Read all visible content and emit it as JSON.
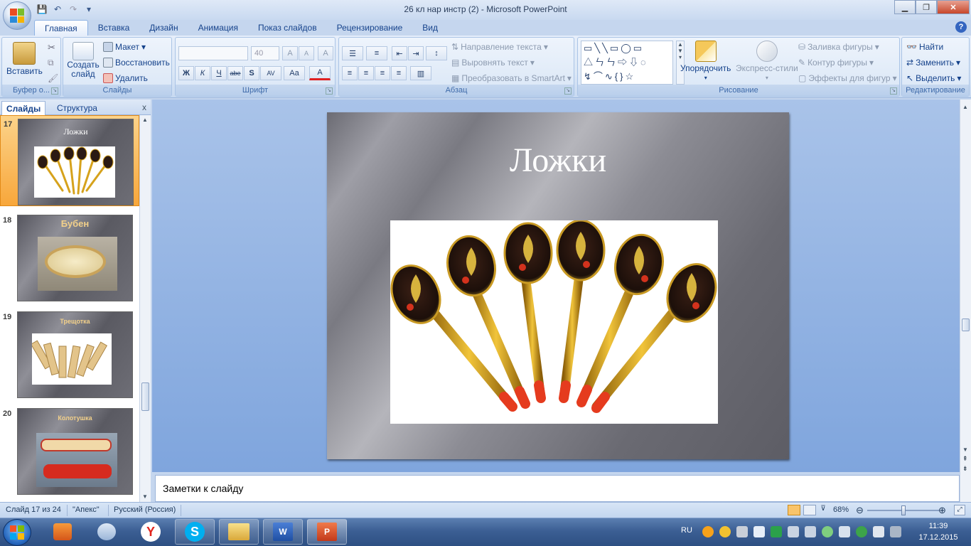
{
  "window": {
    "title": "26 кл нар инстр (2) - Microsoft PowerPoint",
    "minimize": "▁",
    "maximize": "❐",
    "close": "✕"
  },
  "qat": {
    "save": "💾",
    "undo": "↶",
    "redo": "↷",
    "more": "▾"
  },
  "tabs": [
    "Главная",
    "Вставка",
    "Дизайн",
    "Анимация",
    "Показ слайдов",
    "Рецензирование",
    "Вид"
  ],
  "help": "?",
  "ribbon": {
    "clipboard": {
      "paste": "Вставить",
      "label": "Буфер о..."
    },
    "slides": {
      "new_slide": "Создать слайд",
      "layout": "Макет",
      "reset": "Восстановить",
      "delete": "Удалить",
      "label": "Слайды"
    },
    "font": {
      "font_name": "",
      "font_size": "40",
      "grow": "A",
      "shrink": "A",
      "clear": "A",
      "bold": "Ж",
      "italic": "К",
      "underline": "Ч",
      "strike": "abe",
      "shadow": "S",
      "spacing": "AV",
      "case": "Aa",
      "color": "A",
      "label": "Шрифт"
    },
    "paragraph": {
      "text_direction": "Направление текста",
      "align_text": "Выровнять текст",
      "smartart": "Преобразовать в SmartArt",
      "label": "Абзац"
    },
    "drawing": {
      "arrange": "Упорядочить",
      "quick_styles": "Экспресс-стили",
      "fill": "Заливка фигуры",
      "outline": "Контур фигуры",
      "effects": "Эффекты для фигур",
      "label": "Рисование"
    },
    "editing": {
      "find": "Найти",
      "replace": "Заменить",
      "select": "Выделить",
      "label": "Редактирование"
    }
  },
  "pane": {
    "tab_slides": "Слайды",
    "tab_outline": "Структура",
    "close": "x"
  },
  "thumbnails": [
    {
      "num": "17",
      "title": "Ложки",
      "selected": true
    },
    {
      "num": "18",
      "title": "Бубен",
      "selected": false
    },
    {
      "num": "19",
      "title": "Трещотка",
      "selected": false
    },
    {
      "num": "20",
      "title": "Колотушка",
      "selected": false
    }
  ],
  "slide": {
    "title": "Ложки"
  },
  "notes": {
    "placeholder": "Заметки к слайду"
  },
  "status": {
    "slide_info": "Слайд 17 из 24",
    "theme": "\"Апекс\"",
    "language": "Русский (Россия)",
    "zoom": "68%",
    "zoom_fraction": 0.5
  },
  "taskbar": {
    "lang": "RU",
    "time": "11:39",
    "date": "17.12.2015"
  },
  "colors": {
    "accent": "#15428b",
    "ribbon": "#dbe7f6",
    "selected_thumb": "#f8a73b",
    "taskbar": "#3c5f94"
  }
}
